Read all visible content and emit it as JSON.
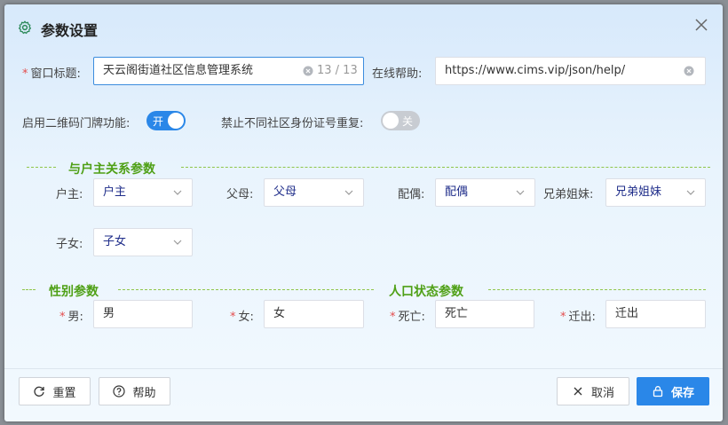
{
  "dialog": {
    "title": "参数设置",
    "title_icon": "gear-icon",
    "close_icon": "close-icon"
  },
  "form": {
    "window_title": {
      "label": "窗口标题:",
      "required": "*",
      "value": "天云阁街道社区信息管理系统",
      "counter": "13 / 13"
    },
    "online_help": {
      "label": "在线帮助:",
      "value": "https://www.cims.vip/json/help/"
    },
    "qr_plate": {
      "label": "启用二维码门牌功能:",
      "state": "开",
      "on": true
    },
    "id_duplicate": {
      "label": "禁止不同社区身份证号重复:",
      "state": "关",
      "on": false
    }
  },
  "relation_section": {
    "title": "与户主关系参数",
    "fields": [
      {
        "label": "户主:",
        "value": "户主"
      },
      {
        "label": "父母:",
        "value": "父母"
      },
      {
        "label": "配偶:",
        "value": "配偶"
      },
      {
        "label": "兄弟姐妹:",
        "value": "兄弟姐妹"
      },
      {
        "label": "子女:",
        "value": "子女"
      }
    ]
  },
  "gender_section": {
    "title": "性别参数",
    "fields": [
      {
        "label": "男:",
        "value": "男",
        "required": "*"
      },
      {
        "label": "女:",
        "value": "女",
        "required": "*"
      }
    ]
  },
  "population_section": {
    "title": "人口状态参数",
    "fields": [
      {
        "label": "死亡:",
        "value": "死亡",
        "required": "*"
      },
      {
        "label": "迁出:",
        "value": "迁出",
        "required": "*"
      }
    ]
  },
  "footer": {
    "reset_label": "重置",
    "help_label": "帮助",
    "cancel_label": "取消",
    "save_label": "保存"
  },
  "colors": {
    "accent": "#2a87e8",
    "section_green": "#4fa016",
    "required_red": "#e34d4d"
  }
}
